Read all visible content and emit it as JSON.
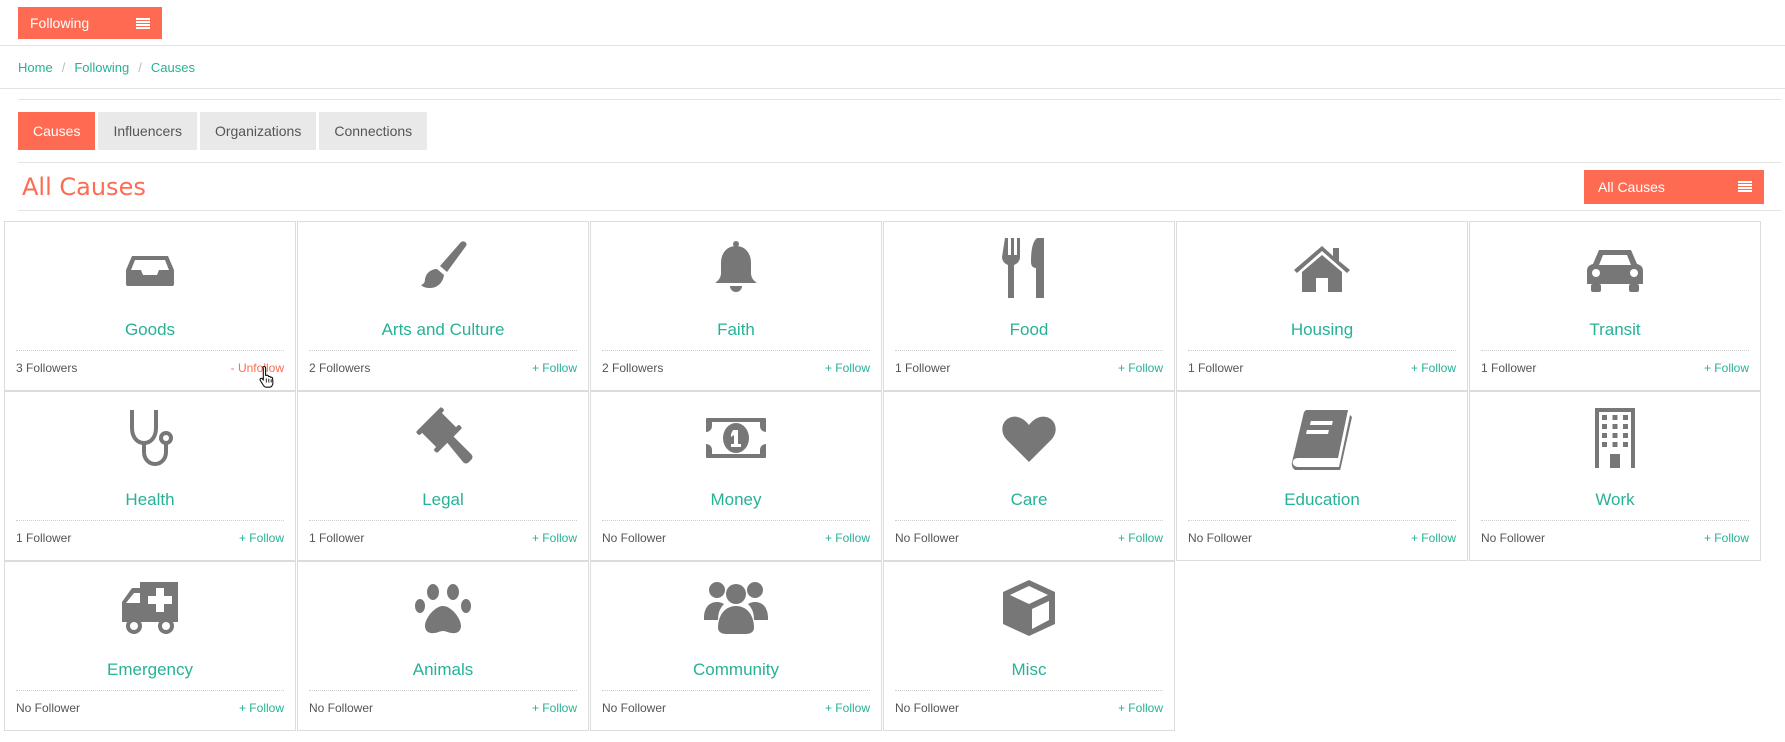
{
  "header": {
    "following_label": "Following",
    "menu_icon": "hamburger-icon"
  },
  "breadcrumb": [
    "Home",
    "Following",
    "Causes"
  ],
  "tabs": [
    {
      "label": "Causes",
      "active": true
    },
    {
      "label": "Influencers",
      "active": false
    },
    {
      "label": "Organizations",
      "active": false
    },
    {
      "label": "Connections",
      "active": false
    }
  ],
  "section": {
    "title": "All Causes",
    "filter_label": "All Causes"
  },
  "colors": {
    "accent": "#ff6b52",
    "link": "#27b197",
    "icon": "#777777"
  },
  "causes": [
    {
      "name": "Goods",
      "icon": "inbox-icon",
      "followers": "3 Followers",
      "action": "- Unfollow",
      "following": true
    },
    {
      "name": "Arts and Culture",
      "icon": "paintbrush-icon",
      "followers": "2 Followers",
      "action": "+ Follow",
      "following": false
    },
    {
      "name": "Faith",
      "icon": "bell-icon",
      "followers": "2 Followers",
      "action": "+ Follow",
      "following": false
    },
    {
      "name": "Food",
      "icon": "cutlery-icon",
      "followers": "1 Follower",
      "action": "+ Follow",
      "following": false
    },
    {
      "name": "Housing",
      "icon": "home-icon",
      "followers": "1 Follower",
      "action": "+ Follow",
      "following": false
    },
    {
      "name": "Transit",
      "icon": "car-icon",
      "followers": "1 Follower",
      "action": "+ Follow",
      "following": false
    },
    {
      "name": "Health",
      "icon": "stethoscope-icon",
      "followers": "1 Follower",
      "action": "+ Follow",
      "following": false
    },
    {
      "name": "Legal",
      "icon": "gavel-icon",
      "followers": "1 Follower",
      "action": "+ Follow",
      "following": false
    },
    {
      "name": "Money",
      "icon": "money-icon",
      "followers": "No Follower",
      "action": "+ Follow",
      "following": false
    },
    {
      "name": "Care",
      "icon": "heart-icon",
      "followers": "No Follower",
      "action": "+ Follow",
      "following": false
    },
    {
      "name": "Education",
      "icon": "book-icon",
      "followers": "No Follower",
      "action": "+ Follow",
      "following": false
    },
    {
      "name": "Work",
      "icon": "building-icon",
      "followers": "No Follower",
      "action": "+ Follow",
      "following": false
    },
    {
      "name": "Emergency",
      "icon": "ambulance-icon",
      "followers": "No Follower",
      "action": "+ Follow",
      "following": false
    },
    {
      "name": "Animals",
      "icon": "paw-icon",
      "followers": "No Follower",
      "action": "+ Follow",
      "following": false
    },
    {
      "name": "Community",
      "icon": "users-icon",
      "followers": "No Follower",
      "action": "+ Follow",
      "following": false
    },
    {
      "name": "Misc",
      "icon": "cube-icon",
      "followers": "No Follower",
      "action": "+ Follow",
      "following": false
    }
  ]
}
